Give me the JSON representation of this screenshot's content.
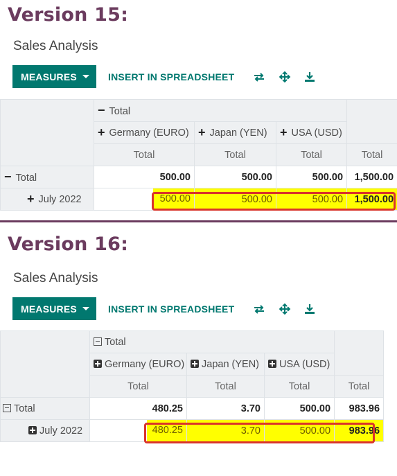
{
  "v15": {
    "version_title": "Version 15:",
    "page_title": "Sales Analysis",
    "measures_label": "MEASURES",
    "insert_label": "INSERT IN SPREADSHEET",
    "header_total": "Total",
    "columns": [
      "Germany (EURO)",
      "Japan (YEN)",
      "USA (USD)"
    ],
    "measure": "Total",
    "rows": [
      {
        "label": "Total",
        "values": [
          "500.00",
          "500.00",
          "500.00",
          "1,500.00"
        ]
      },
      {
        "label": "July 2022",
        "values": [
          "500.00",
          "500.00",
          "500.00",
          "1,500.00"
        ]
      }
    ]
  },
  "v16": {
    "version_title": "Version 16:",
    "page_title": "Sales Analysis",
    "measures_label": "MEASURES",
    "insert_label": "INSERT IN SPREADSHEET",
    "header_total": "Total",
    "columns": [
      "Germany (EURO)",
      "Japan (YEN)",
      "USA (USD)"
    ],
    "measure": "Total",
    "rows": [
      {
        "label": "Total",
        "values": [
          "480.25",
          "3.70",
          "500.00",
          "983.96"
        ]
      },
      {
        "label": "July 2022",
        "values": [
          "480.25",
          "3.70",
          "500.00",
          "983.96"
        ]
      }
    ]
  },
  "colors": {
    "brand": "#01786f",
    "title": "#6b3b5e",
    "highlight": "#ffff00",
    "outline": "#d9342b"
  },
  "icons": [
    "swap-axis-icon",
    "expand-all-icon",
    "download-icon"
  ]
}
